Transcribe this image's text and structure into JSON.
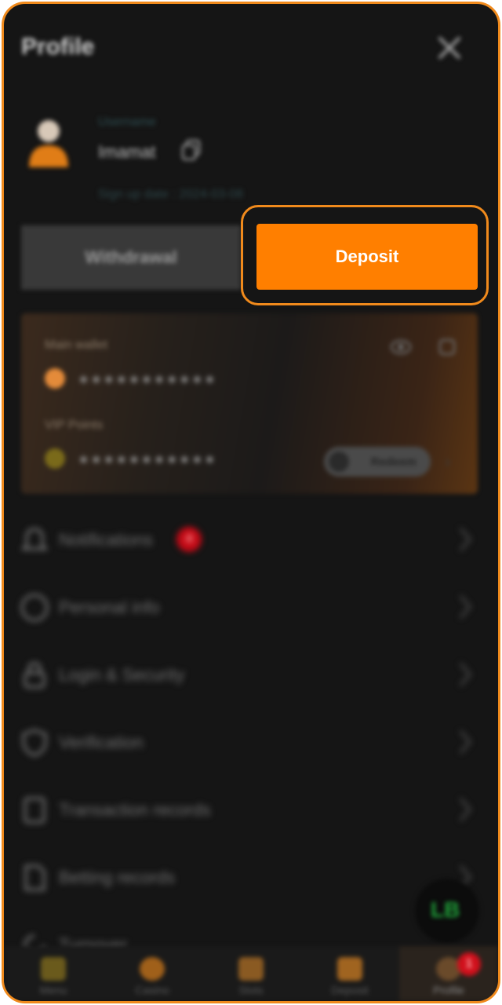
{
  "header": {
    "title": "Profile"
  },
  "user": {
    "username_label": "Username",
    "username": "Imamat",
    "signup": "Sign up date : 2024-03-08"
  },
  "actions": {
    "withdrawal": "Withdrawal",
    "deposit": "Deposit"
  },
  "wallet": {
    "main_label": "Main wallet",
    "main_value": "∗∗∗∗∗∗∗∗∗∗∗",
    "vip_label": "VIP Points",
    "vip_value": "∗∗∗∗∗∗∗∗∗∗∗",
    "redeem_label": "Redeem"
  },
  "menu": [
    {
      "label": "Notifications",
      "badge": "4"
    },
    {
      "label": "Personal info"
    },
    {
      "label": "Login & Security"
    },
    {
      "label": "Verification"
    },
    {
      "label": "Transaction records"
    },
    {
      "label": "Betting records"
    },
    {
      "label": "Turnover"
    }
  ],
  "float_button": {
    "text": "LB"
  },
  "tabs": [
    {
      "label": "Menu"
    },
    {
      "label": "Casino"
    },
    {
      "label": "Slots"
    },
    {
      "label": "Deposit"
    },
    {
      "label": "Profile",
      "badge": "1"
    }
  ],
  "colors": {
    "accent": "#ff7f00",
    "frame": "#f08a1c",
    "background": "#151515",
    "badge": "#c40a16"
  }
}
